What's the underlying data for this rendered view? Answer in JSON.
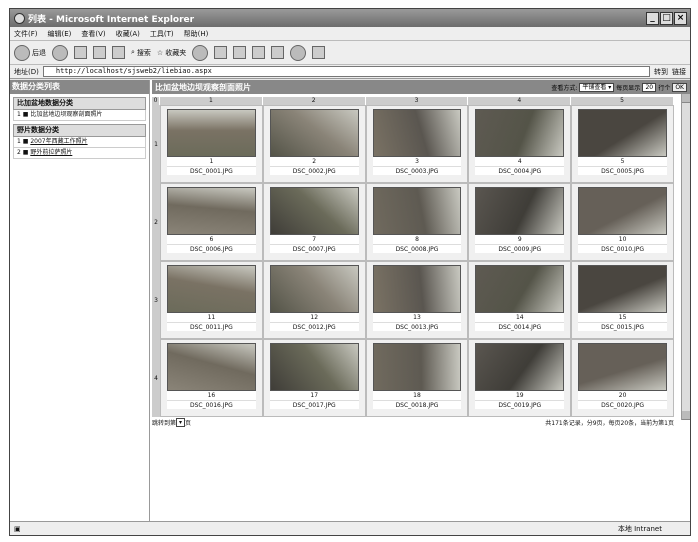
{
  "window": {
    "title": "列表 - Microsoft Internet Explorer"
  },
  "menu": [
    "文件(F)",
    "编辑(E)",
    "查看(V)",
    "收藏(A)",
    "工具(T)",
    "帮助(H)"
  ],
  "toolbar": {
    "back": "后退",
    "search": "搜索",
    "favorites": "收藏夹"
  },
  "address": {
    "label": "地址(D)",
    "url": "http://localhost/sjsweb2/liebiao.aspx",
    "go": "转到",
    "links": "链接"
  },
  "left": {
    "header": "数据分类列表",
    "sections": [
      {
        "title": "比加盆地数据分类",
        "items": [
          {
            "n": "1",
            "label": "比加盆地边坝观察剖面照片"
          }
        ]
      },
      {
        "title": "野片数据分类",
        "items": [
          {
            "n": "1",
            "label": "2007年西藏工作照片"
          },
          {
            "n": "2",
            "label": "野外前拉萨照片"
          }
        ]
      }
    ]
  },
  "right": {
    "header": "比加盆地边坝观察剖面照片",
    "view_label": "查看方式:",
    "view_value": "平铺查看",
    "per_page_label": "每页显示",
    "per_page_value": "20",
    "per_page_unit": "行个",
    "ok": "OK",
    "col_corner": "0",
    "columns": [
      "1",
      "2",
      "3",
      "4",
      "5"
    ],
    "rows": [
      "1",
      "2",
      "3",
      "4"
    ],
    "photos": [
      {
        "num": "1",
        "file": "DSC_0001.JPG"
      },
      {
        "num": "2",
        "file": "DSC_0002.JPG"
      },
      {
        "num": "3",
        "file": "DSC_0003.JPG"
      },
      {
        "num": "4",
        "file": "DSC_0004.JPG"
      },
      {
        "num": "5",
        "file": "DSC_0005.JPG"
      },
      {
        "num": "6",
        "file": "DSC_0006.JPG"
      },
      {
        "num": "7",
        "file": "DSC_0007.JPG"
      },
      {
        "num": "8",
        "file": "DSC_0008.JPG"
      },
      {
        "num": "9",
        "file": "DSC_0009.JPG"
      },
      {
        "num": "10",
        "file": "DSC_0010.JPG"
      },
      {
        "num": "11",
        "file": "DSC_0011.JPG"
      },
      {
        "num": "12",
        "file": "DSC_0012.JPG"
      },
      {
        "num": "13",
        "file": "DSC_0013.JPG"
      },
      {
        "num": "14",
        "file": "DSC_0014.JPG"
      },
      {
        "num": "15",
        "file": "DSC_0015.JPG"
      },
      {
        "num": "16",
        "file": "DSC_0016.JPG"
      },
      {
        "num": "17",
        "file": "DSC_0017.JPG"
      },
      {
        "num": "18",
        "file": "DSC_0018.JPG"
      },
      {
        "num": "19",
        "file": "DSC_0019.JPG"
      },
      {
        "num": "20",
        "file": "DSC_0020.JPG"
      }
    ],
    "jump_label": "跳转到第",
    "jump_unit": "页",
    "summary": "共171条记录，分9页，每页20条，当前为第1页"
  },
  "status": {
    "zone": "本地 Intranet"
  }
}
